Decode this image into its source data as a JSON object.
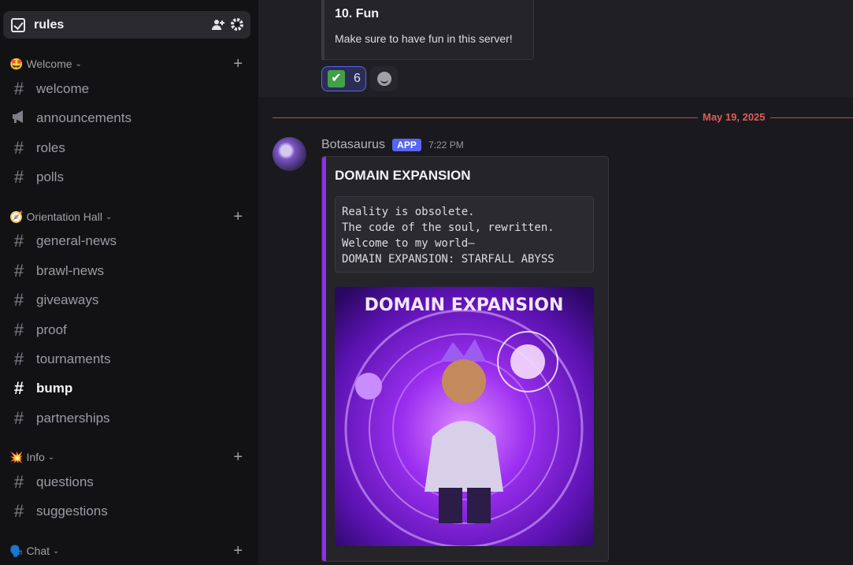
{
  "sidebar": {
    "active_channel": {
      "name": "rules",
      "icon": "rules-checkbox-icon"
    },
    "categories": [
      {
        "emoji": "🤩",
        "label": "Welcome"
      },
      {
        "emoji": "🧭",
        "label": "Orientation Hall"
      },
      {
        "emoji": "💥",
        "label": "Info"
      },
      {
        "emoji": "🗣️",
        "label": "Chat"
      }
    ],
    "channels": [
      {
        "label": "welcome",
        "icon": "hash-icon"
      },
      {
        "label": "announcements",
        "icon": "megaphone-icon"
      },
      {
        "label": "roles",
        "icon": "hash-icon"
      },
      {
        "label": "polls",
        "icon": "hash-icon"
      },
      {
        "label": "general-news",
        "icon": "hash-icon"
      },
      {
        "label": "brawl-news",
        "icon": "hash-icon"
      },
      {
        "label": "giveaways",
        "icon": "hash-lock-icon"
      },
      {
        "label": "proof",
        "icon": "hash-lock-icon"
      },
      {
        "label": "tournaments",
        "icon": "hash-icon"
      },
      {
        "label": "bump",
        "icon": "hash-icon"
      },
      {
        "label": "partnerships",
        "icon": "hash-icon"
      },
      {
        "label": "questions",
        "icon": "hash-icon"
      },
      {
        "label": "suggestions",
        "icon": "hash-icon"
      }
    ]
  },
  "main": {
    "rule_card": {
      "title": "10. Fun",
      "description": "Make sure to have fun in this server!"
    },
    "reaction": {
      "emoji": "✔",
      "count": "6"
    },
    "date_divider": "May 19, 2025",
    "message": {
      "author": "Botasaurus",
      "badge": "APP",
      "time": "7:22 PM",
      "embed": {
        "title": "DOMAIN EXPANSION",
        "code_lines": [
          "Reality is obsolete.",
          "The code of the soul, rewritten.",
          "Welcome to my world—",
          "DOMAIN EXPANSION: STARFALL ABYSS"
        ],
        "image_caption": "DOMAIN EXPANSION"
      }
    }
  },
  "colors": {
    "accent": "#5865f2",
    "embed_bar": "#8c32e8",
    "date_red": "#e05b5b"
  }
}
